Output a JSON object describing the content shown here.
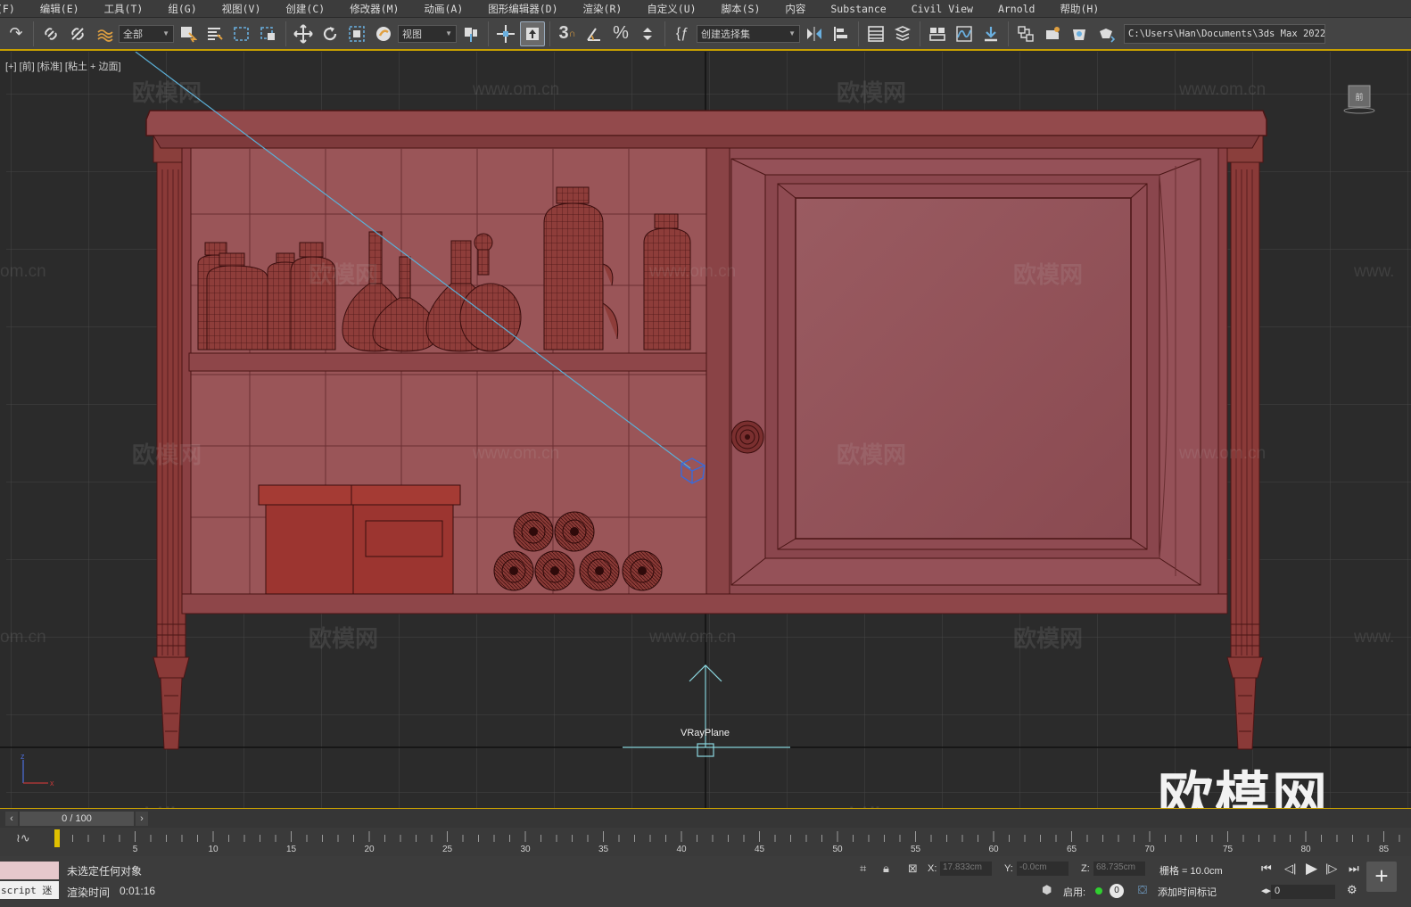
{
  "menu": [
    "(F)",
    "编辑(E)",
    "工具(T)",
    "组(G)",
    "视图(V)",
    "创建(C)",
    "修改器(M)",
    "动画(A)",
    "图形编辑器(D)",
    "渲染(R)",
    "自定义(U)",
    "脚本(S)",
    "内容",
    "Substance",
    "Civil View",
    "Arnold",
    "帮助(H)"
  ],
  "toolbar": {
    "selection_filter": "全部",
    "reference_coord": "视图",
    "snap_value": "3",
    "named_selection": "创建选择集",
    "project_path": "C:\\Users\\Han\\Documents\\3ds Max 2022"
  },
  "viewport": {
    "label": "[+] [前] [标准] [粘土 + 边面]",
    "object_label": "VRayPlane",
    "viewcube_face": "前"
  },
  "watermark": {
    "brand": "欧模网",
    "url": "www.om.cn",
    "url_fragment": "om.cn",
    "url_prefix": "www."
  },
  "timeline": {
    "frame_display": "0 / 100",
    "ticks": [
      "5",
      "10",
      "15",
      "20",
      "25",
      "30",
      "35",
      "40",
      "45",
      "50",
      "55",
      "60",
      "65",
      "70",
      "75",
      "80",
      "85"
    ]
  },
  "status": {
    "maxscript": "script 迷",
    "selection_message": "未选定任何对象",
    "render_time_label": "渲染时间",
    "render_time": "0:01:16",
    "x_label": "X:",
    "x_value": "17.833cm",
    "y_label": "Y:",
    "y_value": "-0.0cm",
    "z_label": "Z:",
    "z_value": "68.735cm",
    "grid": "栅格 = 10.0cm",
    "enable": "启用:",
    "enable_count": "0",
    "add_time_tag": "添加时间标记",
    "current_frame": "0"
  },
  "colors": {
    "model_fill": "#8f4a4d",
    "model_wire": "#4a1515",
    "grid_line": "#4f4f4f",
    "axis_line": "#111111",
    "accent": "#c8a000",
    "helper": "#8cd8e0"
  }
}
